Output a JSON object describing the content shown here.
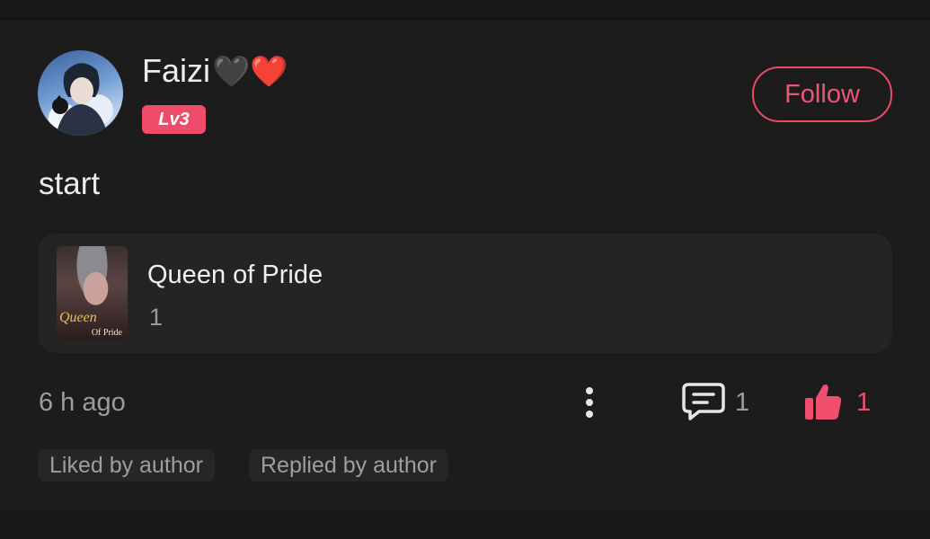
{
  "author": {
    "name": "Faizi",
    "hearts": "🖤❤️",
    "level": "Lv3"
  },
  "follow": {
    "label": "Follow"
  },
  "post": {
    "text": "start"
  },
  "book": {
    "title": "Queen of Pride",
    "count": "1",
    "cover_title": "Queen",
    "cover_subtitle": "Of Pride"
  },
  "meta": {
    "timestamp": "6 h ago",
    "comments": "1",
    "likes": "1"
  },
  "tags": {
    "liked": "Liked by author",
    "replied": "Replied by author"
  },
  "colors": {
    "accent": "#ef4c6c",
    "background": "#1c1c1c",
    "card": "#242424",
    "muted_text": "#9d9d9d"
  }
}
